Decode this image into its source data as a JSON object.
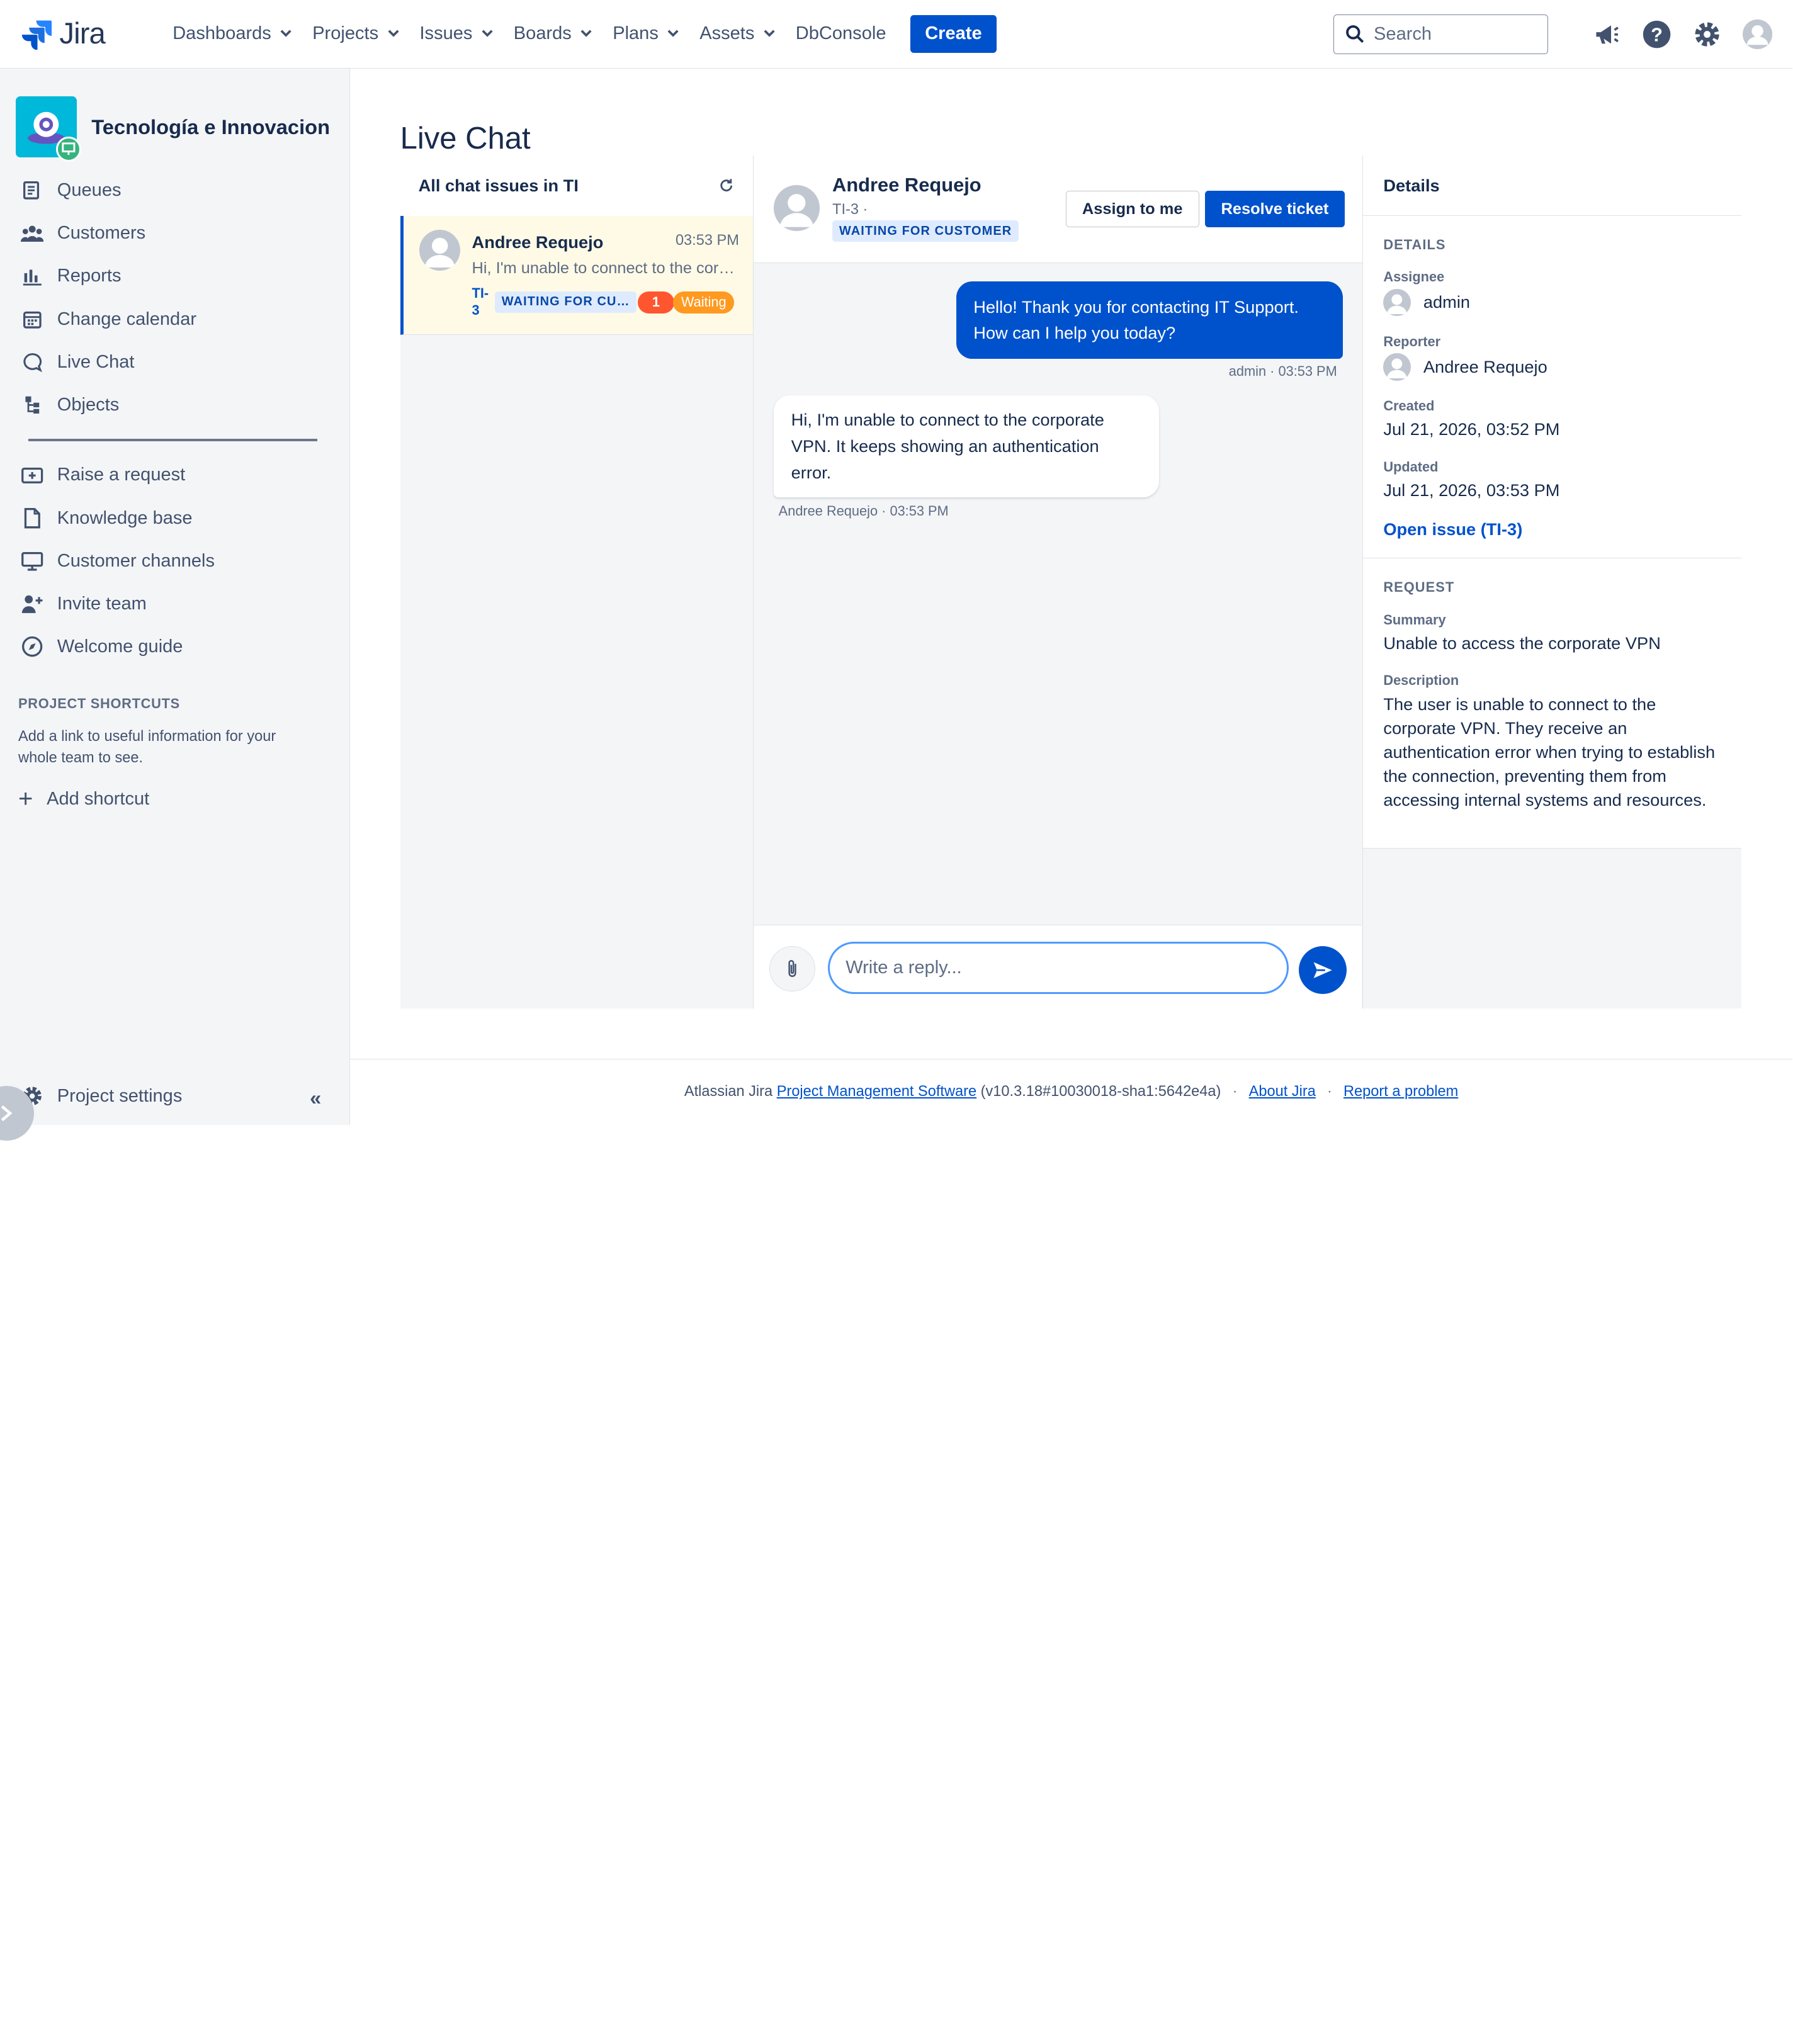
{
  "topnav": {
    "logo_text": "Jira",
    "items": [
      {
        "label": "Dashboards",
        "has_dropdown": true
      },
      {
        "label": "Projects",
        "has_dropdown": true
      },
      {
        "label": "Issues",
        "has_dropdown": true
      },
      {
        "label": "Boards",
        "has_dropdown": true
      },
      {
        "label": "Plans",
        "has_dropdown": true
      },
      {
        "label": "Assets",
        "has_dropdown": true
      },
      {
        "label": "DbConsole",
        "has_dropdown": false
      }
    ],
    "create_label": "Create",
    "search_placeholder": "Search",
    "icons": [
      "megaphone-icon",
      "help-icon",
      "settings-icon",
      "user-avatar"
    ]
  },
  "sidebar": {
    "project_name": "Tecnología e Innovacion",
    "items": [
      {
        "label": "Queues",
        "icon": "queues-icon"
      },
      {
        "label": "Customers",
        "icon": "customers-icon"
      },
      {
        "label": "Reports",
        "icon": "reports-icon"
      },
      {
        "label": "Change calendar",
        "icon": "calendar-icon"
      },
      {
        "label": "Live Chat",
        "icon": "chat-icon"
      },
      {
        "label": "Objects",
        "icon": "objects-icon"
      }
    ],
    "items2": [
      {
        "label": "Raise a request",
        "icon": "raise-request-icon"
      },
      {
        "label": "Knowledge base",
        "icon": "document-icon"
      },
      {
        "label": "Customer channels",
        "icon": "monitor-icon"
      },
      {
        "label": "Invite team",
        "icon": "invite-icon"
      },
      {
        "label": "Welcome guide",
        "icon": "compass-icon"
      }
    ],
    "shortcuts_title": "PROJECT SHORTCUTS",
    "shortcuts_desc": "Add a link to useful information for your whole team to see.",
    "add_shortcut": "Add shortcut",
    "settings_label": "Project settings"
  },
  "page": {
    "title": "Live Chat"
  },
  "chat_list": {
    "header": "All chat issues in TI",
    "cards": [
      {
        "name": "Andree Requejo",
        "time": "03:53 PM",
        "preview": "Hi, I'm unable to connect to the corporate VPN. It keeps showing an authentication error.",
        "key": "TI-3",
        "status": "WAITING FOR CUSTOMER",
        "unread": "1",
        "badge": "Waiting"
      }
    ]
  },
  "conversation": {
    "name": "Andree Requejo",
    "key": "TI-3 ·",
    "status": "WAITING FOR CUSTOMER",
    "assign_label": "Assign to me",
    "resolve_label": "Resolve ticket",
    "messages": [
      {
        "from": "agent",
        "text": "Hello! Thank you for contacting IT Support. How can I help you today?",
        "meta": "admin · 03:53 PM"
      },
      {
        "from": "customer",
        "text": "Hi, I'm unable to connect to the corporate VPN. It keeps showing an authentication error.",
        "meta": "Andree Requejo · 03:53 PM"
      }
    ],
    "reply_placeholder": "Write a reply..."
  },
  "details": {
    "header": "Details",
    "section1_title": "DETAILS",
    "assignee_label": "Assignee",
    "assignee": "admin",
    "reporter_label": "Reporter",
    "reporter": "Andree Requejo",
    "created_label": "Created",
    "created": "Jul 21, 2026, 03:52 PM",
    "updated_label": "Updated",
    "updated": "Jul 21, 2026, 03:53 PM",
    "open_issue": "Open issue (TI-3)",
    "section2_title": "REQUEST",
    "summary_label": "Summary",
    "summary": "Unable to access the corporate VPN",
    "description_label": "Description",
    "description": "The user is unable to connect to the corporate VPN. They receive an authentication error when trying to establish the connection, preventing them from accessing internal systems and resources."
  },
  "footer": {
    "prefix": "Atlassian Jira",
    "pms_link": "Project Management Software",
    "version": "(v10.3.18#10030018-sha1:5642e4a)",
    "about": "About Jira",
    "report": "Report a problem"
  },
  "colors": {
    "brand": "#0052cc",
    "sidebar_bg": "#f4f5f7",
    "waiting": "#ff991f",
    "unread": "#ff5630",
    "selected_card": "#fffae6"
  }
}
